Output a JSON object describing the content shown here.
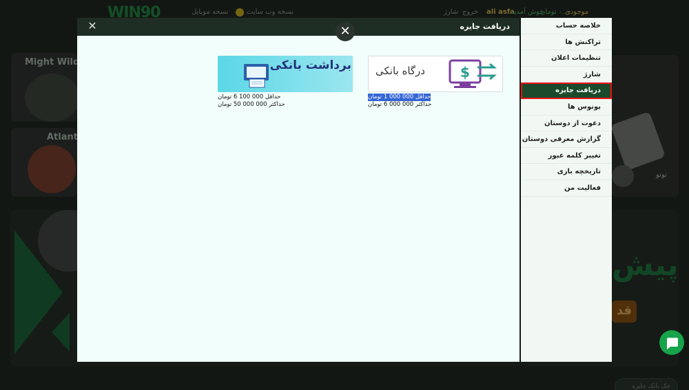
{
  "header": {
    "logo": "WIN90",
    "mobile_version": "نسخه موبایل",
    "web_version": "نسخه وب سایت",
    "charge": "شارژ",
    "logout": "خروج",
    "welcome": "خوش آمدید:",
    "username": "ali asfa",
    "balance_label": "موجودی",
    "balance_value": "۰.۰۰ تومان"
  },
  "background": {
    "tiles": [
      {
        "title": "Might Wild P"
      },
      {
        "title": "Atlantis"
      }
    ],
    "right_tile_label": "توتو",
    "banner_word": "پیش",
    "banner_button": "قد",
    "bottom_pill": "چک بانک جایزه"
  },
  "sidebar": {
    "items": [
      {
        "label": "خلاصه حساب"
      },
      {
        "label": "تراکنش ها"
      },
      {
        "label": "تنظیمات اعلان"
      },
      {
        "label": "شارژ"
      },
      {
        "label": "دریافت جایزه"
      },
      {
        "label": "بونوس ها"
      },
      {
        "label": "دعوت از دوستان"
      },
      {
        "label": "گزارش معرفی دوستان"
      },
      {
        "label": "تغییر کلمه عبور"
      },
      {
        "label": "تاریخچه بازی"
      },
      {
        "label": "فعالیت من"
      }
    ],
    "active_index": 4
  },
  "modal": {
    "title": "دریافت جایزه",
    "methods": [
      {
        "name": "درگاه بانکی",
        "min": "حداقل 000 000 1 تومان",
        "max": "حداکثر 000 000 6 تومان"
      },
      {
        "name": "برداشت بانکی",
        "min": "حداقل 000 100 6 تومان",
        "max": "حداکثر 000 000 50 تومان"
      }
    ]
  },
  "colors": {
    "accent_green": "#1a4a2b",
    "active_outline": "#e11111",
    "selection": "#3465d6",
    "chat": "#16a34a"
  },
  "icons": [
    "close-icon",
    "bank-gateway-icon",
    "bank-withdraw-icon",
    "chat-icon",
    "coin-icon"
  ]
}
